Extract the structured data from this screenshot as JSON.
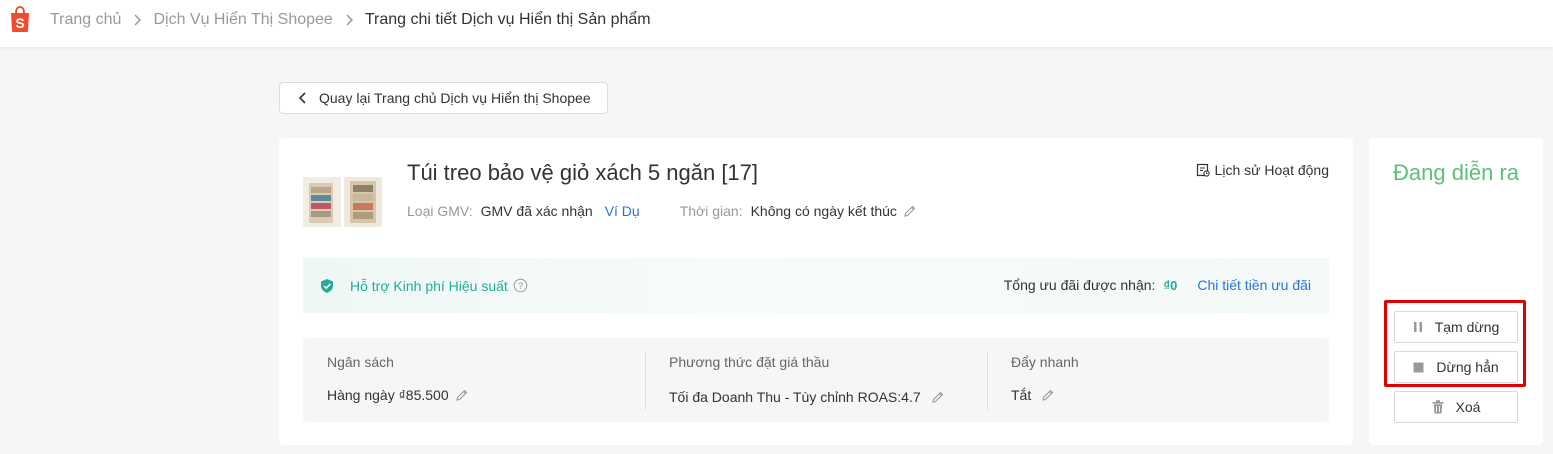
{
  "breadcrumb": {
    "items": [
      "Trang chủ",
      "Dịch Vụ Hiển Thị Shopee",
      "Trang chi tiết Dịch vụ Hiển thị Sản phẩm"
    ]
  },
  "back_button": "Quay lại Trang chủ Dịch vụ Hiển thị Shopee",
  "product": {
    "title": "Túi treo bảo vệ giỏ xách 5 ngăn [17]",
    "gmv_label": "Loại GMV:",
    "gmv_value": "GMV đã xác nhận",
    "gmv_example": "Ví Dụ",
    "time_label": "Thời gian:",
    "time_value": "Không có ngày kết thúc"
  },
  "history_link": "Lịch sử Hoạt động",
  "support": {
    "label": "Hỗ trợ Kinh phí Hiệu suất",
    "total_label": "Tổng ưu đãi được nhận:",
    "total_value": "₫0",
    "detail_link": "Chi tiết tiền ưu đãi"
  },
  "stats": {
    "budget_label": "Ngân sách",
    "budget_value": "Hàng ngày ₫85.500",
    "bid_label": "Phương thức đặt giá thầu",
    "bid_value": "Tối đa Doanh Thu - Tùy chỉnh ROAS:4.7",
    "boost_label": "Đẩy nhanh",
    "boost_value": "Tắt"
  },
  "status_panel": {
    "status": "Đang diễn ra",
    "pause_label": "Tạm dừng",
    "stop_label": "Dừng hẳn",
    "delete_label": "Xoá"
  },
  "colors": {
    "brand": "#ee4d2d",
    "status_green": "#5bc07a",
    "teal": "#26aa99",
    "link_blue": "#2673dd",
    "highlight_red": "#e00000"
  }
}
